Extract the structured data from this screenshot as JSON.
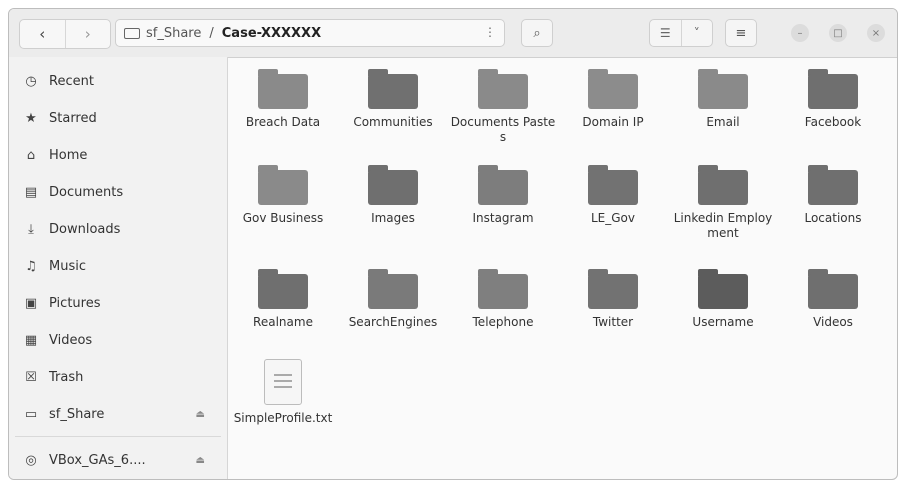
{
  "header": {
    "back_glyph": "‹",
    "forward_glyph": "›",
    "breadcrumb": [
      {
        "label": "sf_Share",
        "icon": "drive-icon"
      },
      {
        "label": "Case-XXXXXX"
      }
    ],
    "separator": "/",
    "path_menu_glyph": "⋮",
    "search_glyph": "⌕",
    "list_view_glyph": "☰",
    "view_options_glyph": "˅",
    "menu_glyph": "≡",
    "minimize_glyph": "–",
    "maximize_glyph": "□",
    "close_glyph": "×"
  },
  "sidebar": {
    "items": [
      {
        "label": "Recent",
        "icon": "clock-icon",
        "glyph": "◷"
      },
      {
        "label": "Starred",
        "icon": "star-icon",
        "glyph": "★"
      },
      {
        "label": "Home",
        "icon": "home-icon",
        "glyph": "⌂"
      },
      {
        "label": "Documents",
        "icon": "documents-icon",
        "glyph": "▤"
      },
      {
        "label": "Downloads",
        "icon": "download-icon",
        "glyph": "⤓"
      },
      {
        "label": "Music",
        "icon": "music-icon",
        "glyph": "♫"
      },
      {
        "label": "Pictures",
        "icon": "pictures-icon",
        "glyph": "▣"
      },
      {
        "label": "Videos",
        "icon": "videos-icon",
        "glyph": "▦"
      },
      {
        "label": "Trash",
        "icon": "trash-icon",
        "glyph": "☒"
      },
      {
        "label": "sf_Share",
        "icon": "drive-icon",
        "glyph": "▭",
        "eject": "⏏"
      },
      {
        "label": "VBox_GAs_6....",
        "icon": "disc-icon",
        "glyph": "◎",
        "eject": "⏏"
      }
    ]
  },
  "files": [
    {
      "name": "Breach Data",
      "type": "folder",
      "color": "#8a8a8a"
    },
    {
      "name": "Communities",
      "type": "folder",
      "color": "#707070"
    },
    {
      "name": "Documents Pastes",
      "type": "folder",
      "color": "#8a8a8a"
    },
    {
      "name": "Domain IP",
      "type": "folder",
      "color": "#8c8c8c"
    },
    {
      "name": "Email",
      "type": "folder",
      "color": "#8a8a8a"
    },
    {
      "name": "Facebook",
      "type": "folder",
      "color": "#6f6f6f"
    },
    {
      "name": "Gov Business",
      "type": "folder",
      "color": "#8a8a8a"
    },
    {
      "name": "Images",
      "type": "folder",
      "color": "#6f6f6f"
    },
    {
      "name": "Instagram",
      "type": "folder",
      "color": "#7d7d7d"
    },
    {
      "name": "LE_Gov",
      "type": "folder",
      "color": "#727272"
    },
    {
      "name": "Linkedin Employment",
      "type": "folder",
      "color": "#6f6f6f"
    },
    {
      "name": "Locations",
      "type": "folder",
      "color": "#6f6f6f"
    },
    {
      "name": "Realname",
      "type": "folder",
      "color": "#6f6f6f"
    },
    {
      "name": "SearchEngines",
      "type": "folder",
      "color": "#7a7a7a"
    },
    {
      "name": "Telephone",
      "type": "folder",
      "color": "#7f7f7f"
    },
    {
      "name": "Twitter",
      "type": "folder",
      "color": "#727272"
    },
    {
      "name": "Username",
      "type": "folder",
      "color": "#5c5c5c"
    },
    {
      "name": "Videos",
      "type": "folder",
      "color": "#6f6f6f"
    },
    {
      "name": "SimpleProfile.txt",
      "type": "text-file",
      "color": "#f6f6f6"
    }
  ]
}
